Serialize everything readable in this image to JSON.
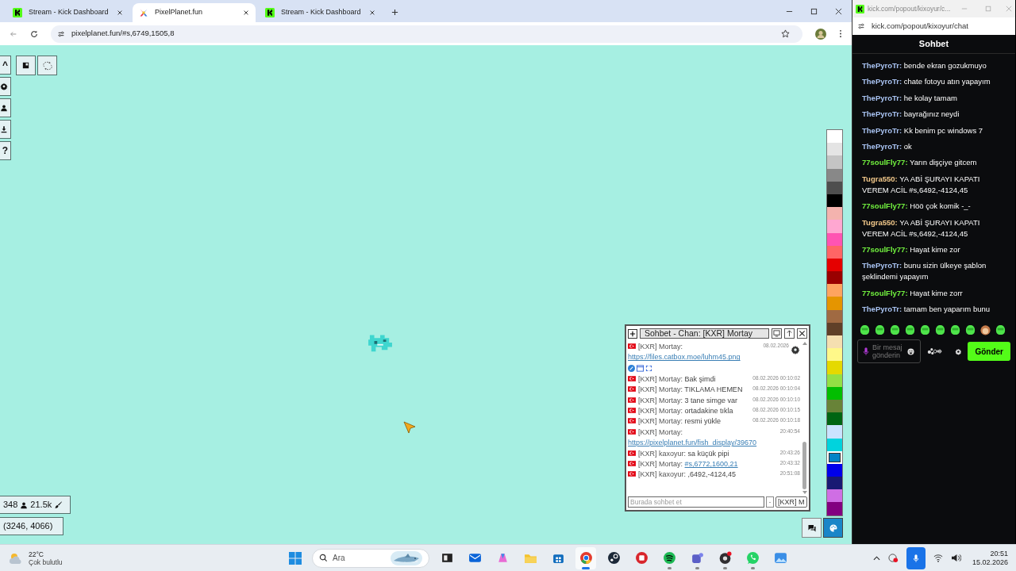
{
  "browser": {
    "tabs": [
      {
        "title": "Stream - Kick Dashboard",
        "kind": "kick",
        "selected": false
      },
      {
        "title": "PixelPlanet.fun",
        "kind": "pixelplanet",
        "selected": true
      },
      {
        "title": "Stream - Kick Dashboard",
        "kind": "kick",
        "selected": false
      }
    ],
    "url": "pixelplanet.fun/#s,6749,1505,8"
  },
  "canvas": {
    "menu_buttons": [
      {
        "kind": "text",
        "label": "^"
      },
      {
        "kind": "gear"
      },
      {
        "kind": "user"
      },
      {
        "kind": "download"
      },
      {
        "kind": "text",
        "label": "?"
      }
    ],
    "tool_buttons": [
      {
        "kind": "window"
      },
      {
        "kind": "rotate"
      }
    ],
    "online_count": "348",
    "pixel_count": "21.5k",
    "coordinates": "(3246, 4066)"
  },
  "palette": [
    {
      "color": "#ffffff",
      "selected": false
    },
    {
      "color": "#e4e4e4",
      "selected": false
    },
    {
      "color": "#c4c4c4",
      "selected": false
    },
    {
      "color": "#888888",
      "selected": false
    },
    {
      "color": "#4e4e4e",
      "selected": false
    },
    {
      "color": "#000000",
      "selected": false
    },
    {
      "color": "#f4b3ae",
      "selected": false
    },
    {
      "color": "#ffa7d1",
      "selected": false
    },
    {
      "color": "#ff54b2",
      "selected": false
    },
    {
      "color": "#ff6565",
      "selected": false
    },
    {
      "color": "#e50000",
      "selected": false
    },
    {
      "color": "#9a0000",
      "selected": false
    },
    {
      "color": "#fea460",
      "selected": false
    },
    {
      "color": "#e59500",
      "selected": false
    },
    {
      "color": "#a06a42",
      "selected": false
    },
    {
      "color": "#604028",
      "selected": false
    },
    {
      "color": "#f5dfb0",
      "selected": false
    },
    {
      "color": "#fff889",
      "selected": false
    },
    {
      "color": "#e5d900",
      "selected": false
    },
    {
      "color": "#94e044",
      "selected": false
    },
    {
      "color": "#02be01",
      "selected": false
    },
    {
      "color": "#688338",
      "selected": false
    },
    {
      "color": "#006513",
      "selected": false
    },
    {
      "color": "#cae3ff",
      "selected": false
    },
    {
      "color": "#00d3dd",
      "selected": false
    },
    {
      "color": "#0083c7",
      "selected": true
    },
    {
      "color": "#0000ea",
      "selected": false
    },
    {
      "color": "#191973",
      "selected": false
    },
    {
      "color": "#cf6ee4",
      "selected": false
    },
    {
      "color": "#820080",
      "selected": false
    }
  ],
  "chat_window": {
    "title": "Sohbet - Chan: [KXR] Mortay",
    "messages": [
      {
        "kind": "link_embed",
        "author": "[KXR] Mortay:",
        "link": "https://files.catbox.moe/luhm45.png",
        "time": "08.02.2026"
      },
      {
        "kind": "text",
        "author": "[KXR] Mortay:",
        "text": "Bak şimdi",
        "time": "08.02.2026 00:10:02"
      },
      {
        "kind": "text",
        "author": "[KXR] Mortay:",
        "text": "TIKLAMA HEMEN",
        "time": "08.02.2026 00:10:04"
      },
      {
        "kind": "text",
        "author": "[KXR] Mortay:",
        "text": "3 tane simge var",
        "time": "08.02.2026 00:10:10"
      },
      {
        "kind": "text",
        "author": "[KXR] Mortay:",
        "text": "ortadakine tıkla",
        "time": "08.02.2026 00:10:15"
      },
      {
        "kind": "text",
        "author": "[KXR] Mortay:",
        "text": "resmi yükle",
        "time": "08.02.2026 00:10:18"
      },
      {
        "kind": "link",
        "author": "[KXR] Mortay:",
        "link": "https://pixelplanet.fun/fish_display/39670",
        "time": "20:40:54"
      },
      {
        "kind": "text",
        "author": "[KXR] kaxoyur:",
        "text": "sa küçük pipi",
        "time": "20:43:26"
      },
      {
        "kind": "inline_link",
        "author": "[KXR] Mortay:",
        "link": "#s,6772,1600,21",
        "time": "20:43:32"
      },
      {
        "kind": "text",
        "author": "[KXR] kaxoyur:",
        "text": ",6492,-4124,45",
        "time": "20:51:08"
      }
    ],
    "placeholder": "Burada sohbet et",
    "send_label": "·",
    "channel": "[KXR] M"
  },
  "bottom_buttons": [
    {
      "kind": "chat",
      "selected": false
    },
    {
      "kind": "palette",
      "selected": true
    }
  ],
  "kick_popout": {
    "window_title": "kick.com/popout/kixoyur/c...",
    "url": "kick.com/popout/kixoyur/chat",
    "header": "Sohbet",
    "messages": [
      {
        "user": "ThePyroTr:",
        "color": "#a9c3f2",
        "text": "bende ekran gozukmuyo"
      },
      {
        "user": "ThePyroTr:",
        "color": "#a9c3f2",
        "text": "chate fotoyu atın yapayım"
      },
      {
        "user": "ThePyroTr:",
        "color": "#a9c3f2",
        "text": "he kolay tamam"
      },
      {
        "user": "ThePyroTr:",
        "color": "#a9c3f2",
        "text": "bayrağınız neydi"
      },
      {
        "user": "ThePyroTr:",
        "color": "#a9c3f2",
        "text": "Kk benim pc windows 7"
      },
      {
        "user": "ThePyroTr:",
        "color": "#a9c3f2",
        "text": "ok"
      },
      {
        "user": "77soulFly77:",
        "color": "#72f23f",
        "text": "Yarın dişçiye gitcem"
      },
      {
        "user": "Tugra550:",
        "color": "#f3c98b",
        "text": "YA ABİ ŞURAYI KAPATI VEREM ACİL #s,6492,-4124,45"
      },
      {
        "user": "77soulFly77:",
        "color": "#72f23f",
        "text": "Höö çok komik -_-"
      },
      {
        "user": "Tugra550:",
        "color": "#f3c98b",
        "text": "YA ABİ ŞURAYI KAPATI VEREM ACİL #s,6492,-4124,45"
      },
      {
        "user": "77soulFly77:",
        "color": "#72f23f",
        "text": "Hayat kime zor"
      },
      {
        "user": "ThePyroTr:",
        "color": "#a9c3f2",
        "text": "bunu sizin ülkeye şablon şeklindemi yapayım"
      },
      {
        "user": "77soulFly77:",
        "color": "#72f23f",
        "text": "Hayat kime zorr"
      },
      {
        "user": "ThePyroTr:",
        "color": "#a9c3f2",
        "text": "tamam ben yaparım bunu"
      }
    ],
    "placeholder": "Bir mesaj gönderin",
    "send_label": "Gönder"
  },
  "taskbar": {
    "temperature": "22°C",
    "weather": "Çok bulutlu",
    "search_placeholder": "Ara",
    "apps": [
      {
        "kind": "taskview",
        "running": false,
        "selected": false
      },
      {
        "kind": "mail",
        "running": false,
        "selected": false
      },
      {
        "kind": "copilot",
        "running": false,
        "selected": false
      },
      {
        "kind": "folder",
        "running": false,
        "selected": false
      },
      {
        "kind": "store",
        "running": false,
        "selected": false
      },
      {
        "kind": "chrome",
        "running": true,
        "selected": true
      },
      {
        "kind": "steam",
        "running": false,
        "selected": false
      },
      {
        "kind": "redapp",
        "running": false,
        "selected": false
      },
      {
        "kind": "spotify",
        "running": true,
        "selected": false
      },
      {
        "kind": "teams",
        "running": true,
        "selected": false
      },
      {
        "kind": "recorder",
        "running": true,
        "selected": false
      },
      {
        "kind": "whatsapp",
        "running": true,
        "selected": false
      },
      {
        "kind": "photos",
        "running": false,
        "selected": false
      }
    ],
    "time": "20:51",
    "date": "15.02.2026"
  }
}
